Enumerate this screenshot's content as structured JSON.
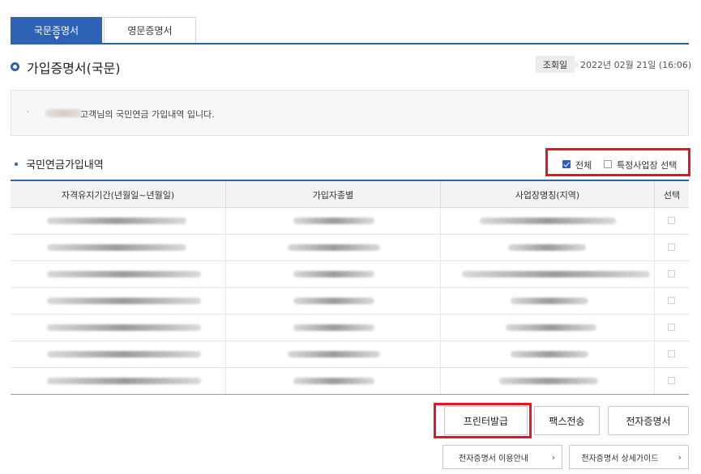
{
  "tabs": [
    {
      "label": "국문증명서",
      "active": true
    },
    {
      "label": "영문증명서",
      "active": false
    }
  ],
  "page_title": "가입증명서(국문)",
  "inquiry": {
    "label": "조회일",
    "date": "2022년 02월 21일 (16:06)"
  },
  "notice": {
    "bullet": "·",
    "message": "고객님의 국민연금 가입내역 입니다."
  },
  "section": {
    "title": "국민연금가입내역",
    "filter": {
      "all_label": "전체",
      "all_checked": true,
      "specific_label": "특정사업장 선택",
      "specific_checked": false
    }
  },
  "table": {
    "headers": [
      "자격유지기간(년월일~년월일)",
      "가입자종별",
      "사업장명칭(지역)",
      "선택"
    ],
    "row_count": 7
  },
  "buttons": {
    "print": "프린터발급",
    "fax": "팩스전송",
    "edoc": "전자증명서"
  },
  "links": {
    "guide": "전자증명서 이용안내",
    "detail": "전자증명서 상세가이드",
    "chevron": "›"
  },
  "colors": {
    "accent": "#2d62b4",
    "highlight": "#e8141f"
  }
}
